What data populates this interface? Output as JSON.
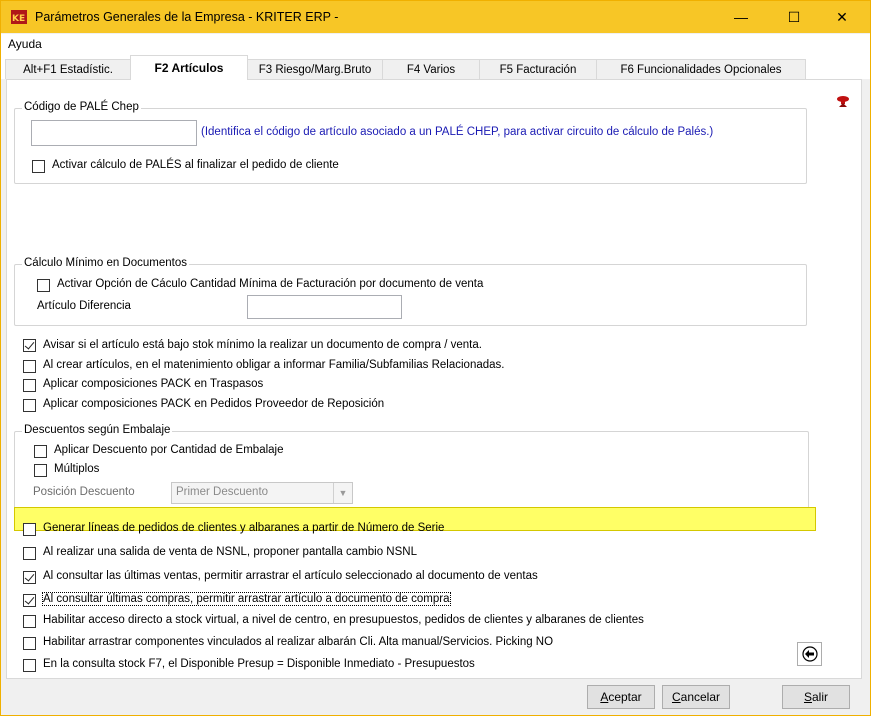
{
  "window": {
    "title": "Parámetros Generales de la Empresa - KRITER ERP -",
    "minimize": "—",
    "maximize": "☐",
    "close": "✕"
  },
  "menu": {
    "help": "Ayuda"
  },
  "tabs": [
    {
      "label": "Alt+F1 Estadístic."
    },
    {
      "label": "F2 Artículos"
    },
    {
      "label": "F3 Riesgo/Marg.Bruto"
    },
    {
      "label": "F4 Varios"
    },
    {
      "label": "F5 Facturación"
    },
    {
      "label": "F6 Funcionalidades Opcionales"
    }
  ],
  "pale": {
    "title": "Código de PALÉ Chep",
    "code_value": "",
    "hint": "(Identifica el código de artículo asociado a un PALÉ CHEP, para activar circuito de cálculo de Palés.)",
    "activate_label": "Activar cálculo de PALÉS al finalizar el pedido de cliente",
    "activate_checked": false
  },
  "minimo": {
    "title": "Cálculo Mínimo en Documentos",
    "activate_label": "Activar Opción de Cáculo Cantidad Mínima de Facturación por documento de venta",
    "activate_checked": false,
    "article_label": "Artículo Diferencia",
    "article_value": ""
  },
  "options1": [
    {
      "label": "Avisar si el artículo está bajo stok mínimo la realizar un documento de compra / venta.",
      "checked": true
    },
    {
      "label": "Al crear artículos, en el matenimiento obligar a informar Familia/Subfamilias Relacionadas.",
      "checked": false
    },
    {
      "label": "Aplicar composiciones PACK en Traspasos",
      "checked": false
    },
    {
      "label": "Aplicar composiciones PACK en Pedidos Proveedor de Reposición",
      "checked": false
    }
  ],
  "embalaje": {
    "title": "Descuentos según Embalaje",
    "apply_label": "Aplicar Descuento por Cantidad de Embalaje",
    "apply_checked": false,
    "multiples_label": "Múltiplos",
    "multiples_checked": false,
    "position_label": "Posición Descuento",
    "position_value": "Primer Descuento"
  },
  "options2": [
    {
      "label": "Generar líneas de pedidos de clientes y albaranes a partir de Número de Serie",
      "checked": false
    },
    {
      "label": "Al realizar una salida de venta de NSNL, proponer pantalla cambio  NSNL",
      "checked": false
    },
    {
      "label": "Al consultar las últimas ventas, permitir arrastrar el artículo seleccionado al documento de ventas",
      "checked": true
    },
    {
      "label": "Al consultar últimas compras, permitir arrastrar artículo a documento de compra",
      "checked": true
    },
    {
      "label": "Habilitar acceso directo a stock virtual, a nivel de centro, en presupuestos, pedidos de clientes y albaranes de clientes",
      "checked": false
    },
    {
      "label": "Habilitar arrastrar componentes vinculados al realizar albarán Cli. Alta manual/Servicios. Picking NO",
      "checked": false
    },
    {
      "label": "En la consulta stock F7, el Disponible Presup = Disponible Inmediato - Presupuestos",
      "checked": false
    }
  ],
  "buttons": {
    "accept_u": "A",
    "accept_rest": "ceptar",
    "cancel_u": "C",
    "cancel_rest": "ancelar",
    "exit_u": "S",
    "exit_rest": "alir"
  },
  "colors": {
    "titlebar": "#f7c626",
    "highlight": "#ffff66",
    "hint": "#1a1ab3"
  }
}
